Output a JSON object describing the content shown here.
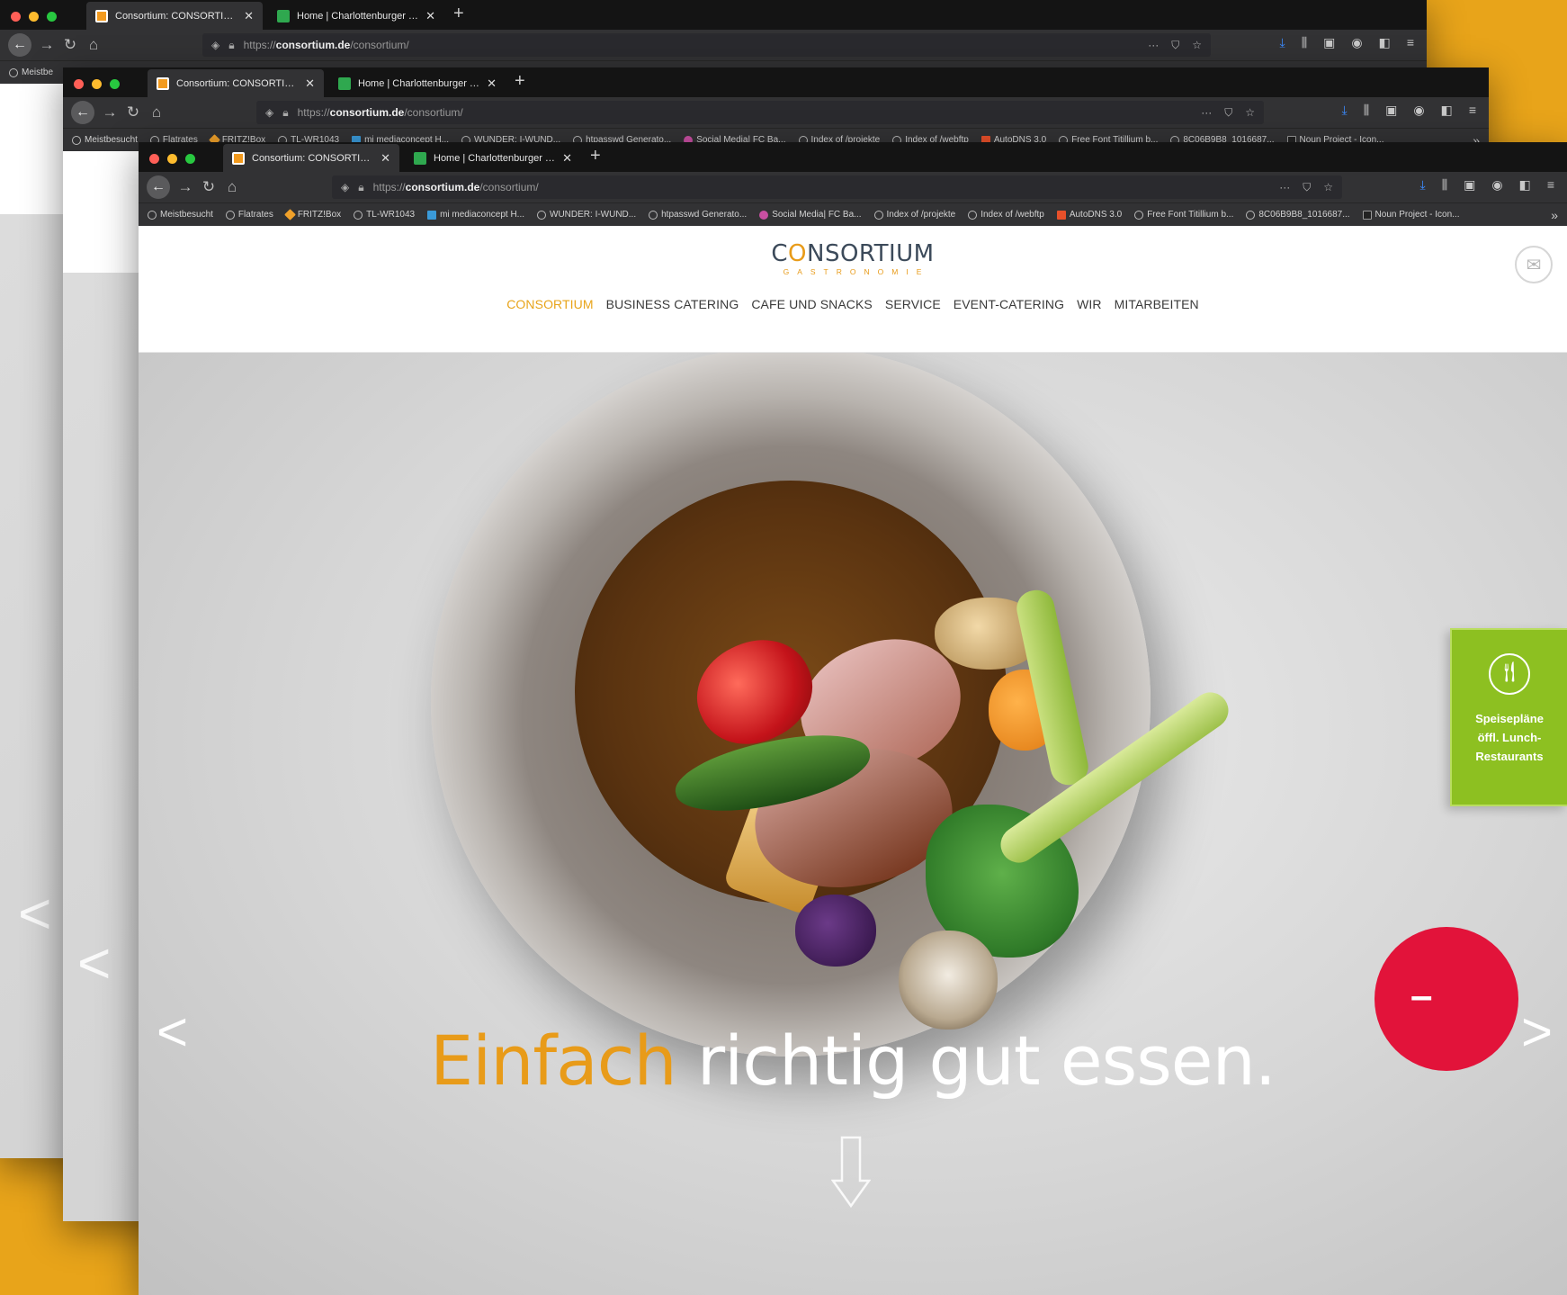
{
  "browser": {
    "tabs": [
      {
        "title": "Consortium: CONSORTIUM",
        "active": true
      },
      {
        "title": "Home | Charlottenburger Bau..."
      }
    ],
    "new_tab": "+",
    "close_glyph": "✕",
    "url_prefix": "https://",
    "url_domain": "consortium.de",
    "url_path": "/consortium/",
    "url_actions": [
      "···",
      "⛉",
      "☆"
    ],
    "toolbar_icons": [
      "download-icon",
      "library-icon",
      "sidebar-icon",
      "account-icon",
      "sync-icon",
      "menu-icon"
    ],
    "bookmarks": [
      {
        "label": "Meistbesucht",
        "icon": "gear-icon"
      },
      {
        "label": "Flatrates",
        "icon": "globe-icon"
      },
      {
        "label": "FRITZ!Box",
        "icon": "fritz-icon"
      },
      {
        "label": "TL-WR1043",
        "icon": "globe-icon"
      },
      {
        "label": "mi mediaconcept H...",
        "icon": "mi-icon"
      },
      {
        "label": "WUNDER: I-WUND...",
        "icon": "page-icon"
      },
      {
        "label": "htpasswd Generato...",
        "icon": "globe-icon"
      },
      {
        "label": "Social Media| FC Ba...",
        "icon": "social-icon"
      },
      {
        "label": "Index of /projekte",
        "icon": "globe-icon"
      },
      {
        "label": "Index of /webftp",
        "icon": "globe-icon"
      },
      {
        "label": "AutoDNS 3.0",
        "icon": "autodns-icon"
      },
      {
        "label": "Free Font Titillium b...",
        "icon": "globe-icon"
      },
      {
        "label": "8C06B9B8_1016687...",
        "icon": "globe-icon"
      },
      {
        "label": "Noun Project - Icon...",
        "icon": "nounproject-icon"
      }
    ],
    "bookmarks_more": "»",
    "win1_bookmark": "Meistbe"
  },
  "site": {
    "logo": {
      "before": "C",
      "o": "O",
      "after": "NSORTIUM",
      "sub": "GASTRONOMIE"
    },
    "nav": [
      {
        "label": "CONSORTIUM",
        "active": true
      },
      {
        "label": "BUSINESS CATERING"
      },
      {
        "label": "CAFE UND SNACKS"
      },
      {
        "label": "SERVICE"
      },
      {
        "label": "EVENT-CATERING"
      },
      {
        "label": "WIR"
      },
      {
        "label": "MITARBEITEN"
      }
    ],
    "mail_icon": "envelope-icon",
    "headline": {
      "orange": "Einfach",
      "white": "richtig gut essen."
    },
    "speiseplan": {
      "line1": "Speisepläne",
      "line2": "öffl. Lunch-",
      "line3": "Restaurants",
      "icon": "cutlery-icon"
    },
    "prev_arrow": "<",
    "next_arrow": ">",
    "red_badge_symbol": "–"
  },
  "colors": {
    "background": "#E8A41A",
    "accent_orange": "#E89B19",
    "speiseplan_green": "#8DC021",
    "badge_red": "#E2133A"
  }
}
